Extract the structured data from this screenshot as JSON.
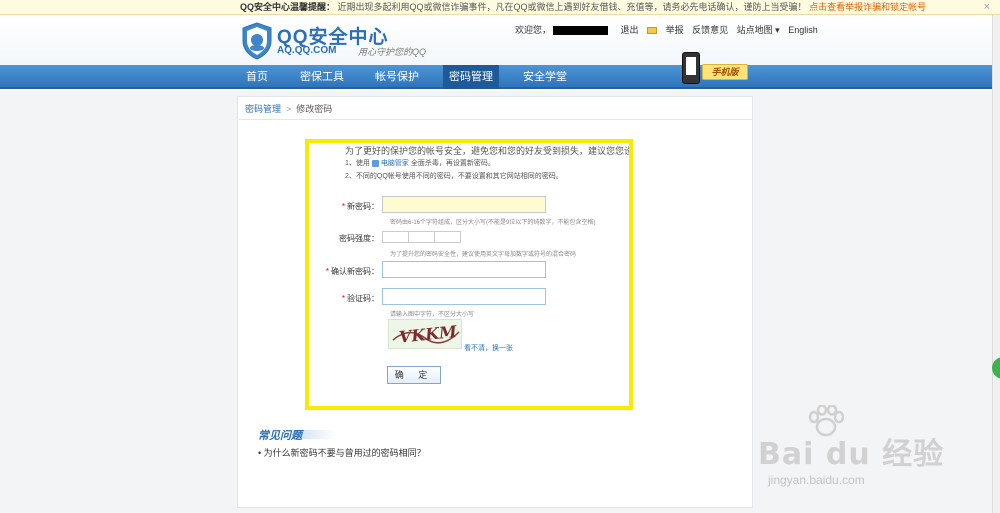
{
  "notice": {
    "prefix": "QQ安全中心温馨提醒：",
    "text": "近期出现多起利用QQ或微信诈骗事件，凡在QQ或微信上遇到好友借钱、充值等，请务必先电话确认，谨防上当受骗！",
    "link": "点击查看举报诈骗和锁定帐号",
    "close": "×"
  },
  "header": {
    "title": "QQ安全中心",
    "domain": "AQ.QQ.COM",
    "slogan": "用心守护您的QQ",
    "welcome": "欢迎您，",
    "logout": "退出",
    "report": "举报",
    "feedback": "反馈意见",
    "sitemap": "站点地图 ▾",
    "english": "English"
  },
  "nav": {
    "items": [
      "首页",
      "密保工具",
      "帐号保护",
      "密码管理",
      "安全学堂"
    ],
    "active_index": 3,
    "mobile_badge": "手机版"
  },
  "breadcrumb": {
    "parent": "密码管理",
    "separator": ">",
    "current": "修改密码"
  },
  "form": {
    "intro": "为了更好的保护您的帐号安全，避免您和您的好友受到损失，建议您您设置密码时：",
    "tip1_prefix": "1、使用",
    "tip1_link": "电脑管家",
    "tip1_suffix": "全面杀毒，再设置新密码。",
    "tip2": "2、不同的QQ帐号使用不同的密码，不要设置和其它网站相同的密码。",
    "new_password_label": "新密码：",
    "new_password_hint": "密码由6-16个字符组成，区分大小写(不能是9位以下的纯数字，不能包含空格)",
    "strength_label": "密码强度：",
    "strength_hint": "为了提升您的密码安全性，建议使用英文字母加数字或符号的混合密码",
    "confirm_label": "确认新密码：",
    "captcha_label": "验证码：",
    "captcha_hint": "请输入图中字符，不区分大小写",
    "captcha_text": "VKKM",
    "refresh_text": "看不清，换一张",
    "submit": "确 定",
    "required_mark": "*"
  },
  "faq": {
    "title": "常见问题",
    "items": [
      "• 为什么新密码不要与曾用过的密码相同？"
    ]
  },
  "watermark": {
    "brand": "Bai du 经验",
    "url": "jingyan.baidu.com"
  },
  "colors": {
    "nav_blue": "#3a82c8",
    "highlight_yellow": "#f7ec00",
    "link_blue": "#2a6fb8",
    "required_red": "#e00000"
  }
}
